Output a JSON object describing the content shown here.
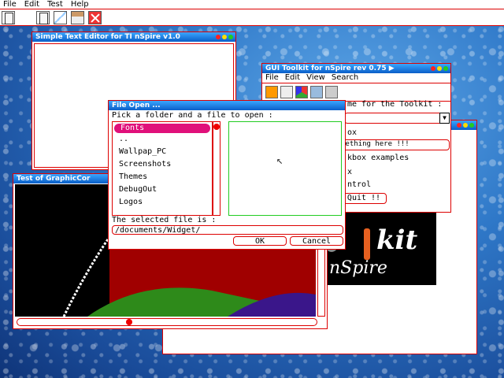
{
  "menubar": {
    "items": [
      "File",
      "Edit",
      "Test",
      "Help"
    ]
  },
  "toolbar": {
    "icons": [
      "new-doc-icon",
      "cut-icon",
      "copy-icon",
      "paste-icon",
      "close-icon"
    ]
  },
  "text_editor": {
    "title": "Simple Text Editor for TI nSpire v1.0"
  },
  "toolkit": {
    "title": "GUI Toolkit for nSpire rev 0.75 ▶",
    "menu": [
      "File",
      "Edit",
      "View",
      "Search"
    ],
    "label_name": "me for the Toolkit :",
    "checkbox_text": "ox",
    "field_text": "mething here !!!",
    "checkbox_examples": "kbox examples",
    "x_text": "x",
    "control_text": "ntrol",
    "quit_button": "Quit !!"
  },
  "logo": {
    "text_top": "kit",
    "text_bottom": "nSpire"
  },
  "graphic": {
    "title": "Test of GraphicCor"
  },
  "file_open": {
    "title": "File Open ...",
    "prompt": "Pick a folder and a file to open :",
    "items": [
      "Fonts",
      "..",
      "Wallpap_PC",
      "Screenshots",
      "Themes",
      "DebugOut",
      "Logos"
    ],
    "selected_label": "The selected file is :",
    "selected_path": "/documents/Widget/",
    "ok": "OK",
    "cancel": "Cancel"
  },
  "colors": {
    "accent": "#dd0000",
    "title_bar": "#0a5ec8",
    "selection": "#e0107a"
  }
}
